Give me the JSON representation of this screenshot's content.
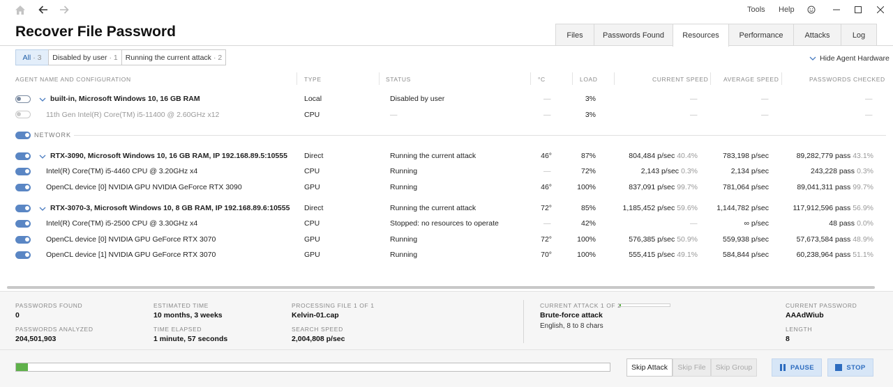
{
  "window": {
    "title": "Recover File Password",
    "menu": [
      "Tools",
      "Help"
    ]
  },
  "tabs": [
    "Files",
    "Passwords Found",
    "Resources",
    "Performance",
    "Attacks",
    "Log"
  ],
  "active_tab": "Resources",
  "filters": [
    {
      "label": "All",
      "count": "· 3"
    },
    {
      "label": "Disabled by user",
      "count": "· 1"
    },
    {
      "label": "Running the current attack",
      "count": "· 2"
    }
  ],
  "hide_hardware_label": "Hide Agent Hardware",
  "columns": [
    "AGENT NAME AND CONFIGURATION",
    "TYPE",
    "STATUS",
    "°C",
    "LOAD",
    "CURRENT SPEED",
    "AVERAGE SPEED",
    "PASSWORDS CHECKED"
  ],
  "network_label": "NETWORK",
  "rows": [
    {
      "name": "built-in, Microsoft Windows 10, 16 GB RAM",
      "type": "Local",
      "status": "Disabled by user",
      "temp": "—",
      "load": "3%",
      "cur_speed": "—",
      "cur_pct": "",
      "avg_speed": "—",
      "checked": "—",
      "checked_pct": ""
    },
    {
      "name": "11th Gen Intel(R) Core(TM) i5-11400 @ 2.60GHz x12",
      "type": "CPU",
      "status": "—",
      "temp": "—",
      "load": "3%",
      "cur_speed": "—",
      "cur_pct": "",
      "avg_speed": "—",
      "checked": "—",
      "checked_pct": ""
    },
    {
      "name": "RTX-3090, Microsoft Windows 10, 16 GB RAM, IP 192.168.89.5:10555",
      "type": "Direct",
      "status": "Running the current attack",
      "temp": "46°",
      "load": "87%",
      "cur_speed": "804,484 p/sec",
      "cur_pct": "40.4%",
      "avg_speed": "783,198 p/sec",
      "checked": "89,282,779 pass",
      "checked_pct": "43.1%"
    },
    {
      "name": "Intel(R) Core(TM) i5-4460  CPU @ 3.20GHz x4",
      "type": "CPU",
      "status": "Running",
      "temp": "—",
      "load": "72%",
      "cur_speed": "2,143 p/sec",
      "cur_pct": "0.3%",
      "avg_speed": "2,134 p/sec",
      "checked": "243,228 pass",
      "checked_pct": "0.3%"
    },
    {
      "name": "OpenCL device [0] NVIDIA GPU NVIDIA GeForce RTX 3090",
      "type": "GPU",
      "status": "Running",
      "temp": "46°",
      "load": "100%",
      "cur_speed": "837,091 p/sec",
      "cur_pct": "99.7%",
      "avg_speed": "781,064 p/sec",
      "checked": "89,041,311 pass",
      "checked_pct": "99.7%"
    },
    {
      "name": "RTX-3070-3, Microsoft Windows 10, 8 GB RAM, IP 192.168.89.6:10555",
      "type": "Direct",
      "status": "Running the current attack",
      "temp": "72°",
      "load": "85%",
      "cur_speed": "1,185,452 p/sec",
      "cur_pct": "59.6%",
      "avg_speed": "1,144,782 p/sec",
      "checked": "117,912,596 pass",
      "checked_pct": "56.9%"
    },
    {
      "name": "Intel(R) Core(TM) i5-2500 CPU @ 3.30GHz x4",
      "type": "CPU",
      "status": "Stopped: no resources to operate",
      "temp": "—",
      "load": "42%",
      "cur_speed": "—",
      "cur_pct": "",
      "avg_speed": "∞ p/sec",
      "checked": "48 pass",
      "checked_pct": "0.0%"
    },
    {
      "name": "OpenCL device [0] NVIDIA GPU GeForce RTX 3070",
      "type": "GPU",
      "status": "Running",
      "temp": "72°",
      "load": "100%",
      "cur_speed": "576,385 p/sec",
      "cur_pct": "50.9%",
      "avg_speed": "559,938 p/sec",
      "checked": "57,673,584 pass",
      "checked_pct": "48.9%"
    },
    {
      "name": "OpenCL device [1] NVIDIA GPU GeForce RTX 3070",
      "type": "GPU",
      "status": "Running",
      "temp": "70°",
      "load": "100%",
      "cur_speed": "555,415 p/sec",
      "cur_pct": "49.1%",
      "avg_speed": "584,844 p/sec",
      "checked": "60,238,964 pass",
      "checked_pct": "51.1%"
    }
  ],
  "footer": {
    "passwords_found_label": "PASSWORDS FOUND",
    "passwords_found": "0",
    "passwords_analyzed_label": "PASSWORDS ANALYZED",
    "passwords_analyzed": "204,501,903",
    "estimated_time_label": "ESTIMATED TIME",
    "estimated_time": "10 months, 3 weeks",
    "time_elapsed_label": "TIME ELAPSED",
    "time_elapsed": "1 minute, 57 seconds",
    "processing_file_label": "PROCESSING FILE 1 OF 1",
    "processing_file": "Kelvin-01.cap",
    "search_speed_label": "SEARCH SPEED",
    "search_speed": "2,004,808 p/sec",
    "current_attack_label": "CURRENT ATTACK 1 OF 2",
    "current_attack": "Brute-force attack",
    "current_attack_detail": "English, 8 to 8 chars",
    "current_attack_progress": 0.03,
    "current_password_label": "CURRENT PASSWORD",
    "current_password": "AAAdWiub",
    "length_label": "LENGTH",
    "length": "8",
    "overall_progress": 0.002
  },
  "buttons": {
    "skip_attack": "Skip Attack",
    "skip_file": "Skip File",
    "skip_group": "Skip Group",
    "pause": "PAUSE",
    "stop": "STOP"
  },
  "colors": {
    "accent": "#2d6cbf",
    "progress": "#5fb14a",
    "toggle_on": "#5a86c4"
  }
}
